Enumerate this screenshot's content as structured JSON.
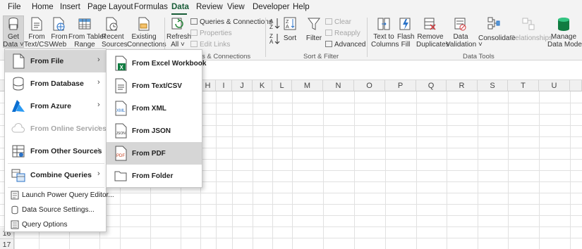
{
  "menubar": {
    "tabs": [
      "File",
      "Home",
      "Insert",
      "Page Layout",
      "Formulas",
      "Data",
      "Review",
      "View",
      "Developer",
      "Help"
    ],
    "active_tab": "Data"
  },
  "ribbon": {
    "get_data": {
      "line1": "Get",
      "line2": "Data ˅"
    },
    "from_text_csv": {
      "line1": "From",
      "line2": "Text/CSV"
    },
    "from_web": {
      "line1": "From",
      "line2": "Web"
    },
    "from_table_range": {
      "line1": "From Table/",
      "line2": "Range"
    },
    "recent_sources": {
      "line1": "Recent",
      "line2": "Sources"
    },
    "existing_connections": {
      "line1": "Existing",
      "line2": "Connections"
    },
    "refresh_all": {
      "line1": "Refresh",
      "line2": "All ˅"
    },
    "queries_connections": "Queries & Connections",
    "properties": "Properties",
    "edit_links": "Edit Links",
    "sort": "Sort",
    "filter": "Filter",
    "clear": "Clear",
    "reapply": "Reapply",
    "advanced": "Advanced",
    "text_to_columns": {
      "line1": "Text to",
      "line2": "Columns"
    },
    "flash_fill": {
      "line1": "Flash",
      "line2": "Fill"
    },
    "remove_duplicates": {
      "line1": "Remove",
      "line2": "Duplicates"
    },
    "data_validation": {
      "line1": "Data",
      "line2": "Validation ˅"
    },
    "consolidate": "Consolidate",
    "relationships": "Relationships",
    "manage_data_model": {
      "line1": "Manage",
      "line2": "Data Model"
    },
    "groups": {
      "queries_connections": "s & Connections",
      "sort_filter": "Sort & Filter",
      "data_tools": "Data Tools"
    }
  },
  "grid": {
    "columns": [
      "H",
      "I",
      "J",
      "K",
      "L",
      "M",
      "N",
      "O",
      "P",
      "Q",
      "R",
      "S",
      "T",
      "U"
    ],
    "rows": [
      "16",
      "17"
    ]
  },
  "get_data_menu": {
    "items": [
      {
        "label": "From File",
        "highlighted": true
      },
      {
        "label": "From Database"
      },
      {
        "label": "From Azure"
      },
      {
        "label": "From Online Services",
        "disabled": true
      },
      {
        "label": "From Other Sources"
      },
      {
        "label": "Combine Queries"
      }
    ],
    "small_items": [
      "Launch Power Query Editor...",
      "Data Source Settings...",
      "Query Options"
    ]
  },
  "from_file_menu": {
    "items": [
      {
        "label": "From Excel Workbook"
      },
      {
        "label": "From Text/CSV"
      },
      {
        "label": "From XML"
      },
      {
        "label": "From JSON"
      },
      {
        "label": "From PDF",
        "highlighted": true
      },
      {
        "label": "From Folder"
      }
    ]
  },
  "icon_text": {
    "xml": "XML",
    "json": "JSON",
    "pdf": "PDF",
    "excel": "X"
  },
  "colors": {
    "accent": "#185c37",
    "highlight": "#d6d6d6",
    "ribbon_bg": "#f3f3f3",
    "disabled": "#a6a6a6"
  }
}
